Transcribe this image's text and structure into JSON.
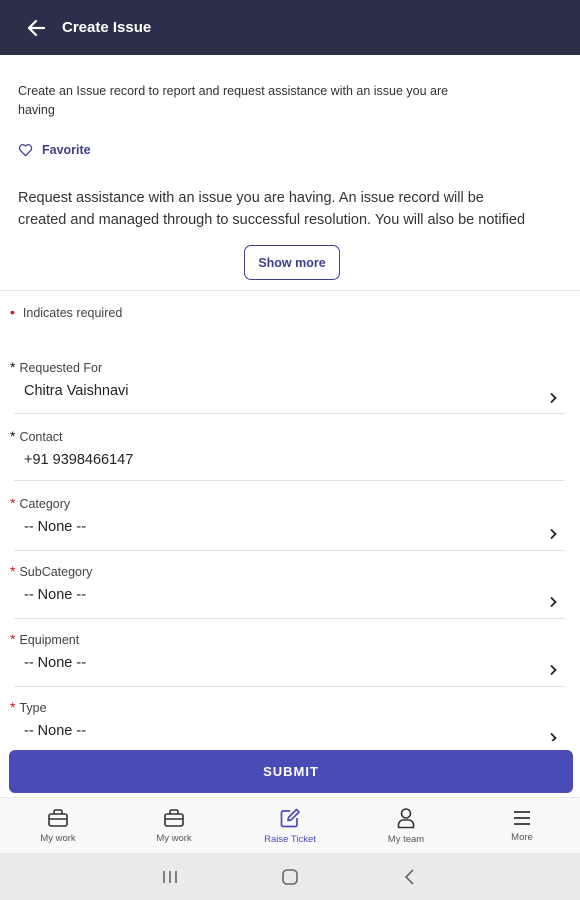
{
  "header": {
    "title": "Create Issue",
    "back_icon": "arrow-left-icon"
  },
  "intro": {
    "description": "Create an Issue record to report and request assistance with an issue you are having",
    "favorite_label": "Favorite",
    "long_description_line1": "Request assistance with an issue you are having. An issue record will be",
    "long_description_line2": "created and managed through to successful resolution. You will also be notified",
    "show_more_label": "Show more"
  },
  "required_note": "Indicates required",
  "fields": [
    {
      "label": "Requested For",
      "value": "Chitra Vaishnavi",
      "marker": "*",
      "marker_color": "#111111",
      "has_chevron": true
    },
    {
      "label": "Contact",
      "value": "+91 9398466147",
      "marker": "*",
      "marker_color": "#111111",
      "has_chevron": false
    },
    {
      "label": "Category",
      "value": "-- None --",
      "marker": "*",
      "marker_color": "#d1142c",
      "has_chevron": true
    },
    {
      "label": "SubCategory",
      "value": "-- None --",
      "marker": "*",
      "marker_color": "#d1142c",
      "has_chevron": true
    },
    {
      "label": "Equipment",
      "value": "-- None --",
      "marker": "*",
      "marker_color": "#d1142c",
      "has_chevron": true
    },
    {
      "label": "Type",
      "value": "-- None --",
      "marker": "*",
      "marker_color": "#d1142c",
      "has_chevron": true
    }
  ],
  "submit_label": "SUBMIT",
  "bottom_nav": [
    {
      "label": "My work",
      "icon": "briefcase-icon",
      "active": false
    },
    {
      "label": "My work",
      "icon": "briefcase-icon",
      "active": false
    },
    {
      "label": "Raise Ticket",
      "icon": "edit-icon",
      "active": true
    },
    {
      "label": "My team",
      "icon": "person-icon",
      "active": false
    },
    {
      "label": "More",
      "icon": "menu-icon",
      "active": false
    }
  ],
  "system_nav": [
    "recent-apps-icon",
    "home-icon",
    "back-icon"
  ],
  "colors": {
    "header_bg": "#2c2f4a",
    "accent": "#4b4bb8",
    "required": "#d1142c"
  }
}
